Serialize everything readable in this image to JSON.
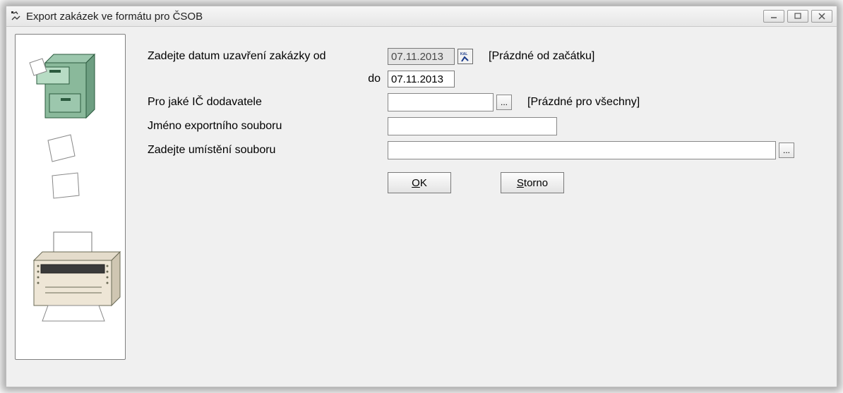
{
  "window": {
    "title": "Export zakázek ve formátu pro ČSOB"
  },
  "form": {
    "date_from_label": "Zadejte datum uzavření zakázky od",
    "date_to_label": "do",
    "date_from_value": "07.11.2013",
    "date_to_value": "07.11.2013",
    "date_hint": "[Prázdné od začátku]",
    "ic_label": "Pro jaké IČ dodavatele",
    "ic_value": "",
    "ic_browse": "...",
    "ic_hint": "[Prázdné pro všechny]",
    "filename_label": "Jméno exportního souboru",
    "filename_value": "",
    "path_label": "Zadejte umístění souboru",
    "path_value": "",
    "path_browse": "..."
  },
  "buttons": {
    "ok_mnemonic": "O",
    "ok_rest": "K",
    "storno_mnemonic": "S",
    "storno_rest": "torno"
  },
  "icons": {
    "calendar_label": "KAL"
  }
}
